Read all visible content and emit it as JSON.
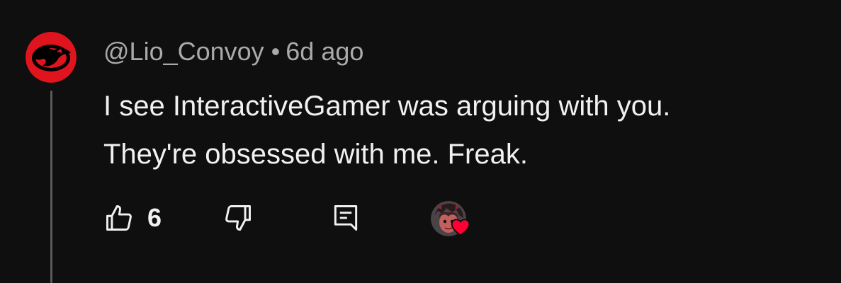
{
  "comment": {
    "author": "@Lio_Convoy",
    "separator": "•",
    "time": "6d ago",
    "text_line1": "I see InteractiveGamer was arguing with you.",
    "text_line2": "They're obsessed with me. Freak.",
    "like_count": "6",
    "avatar_icon": "thundercats-logo-icon",
    "hearted_by_icon": "creator-avatar-icon",
    "heart_color": "#ff0033",
    "avatar_color": "#e0141e"
  }
}
